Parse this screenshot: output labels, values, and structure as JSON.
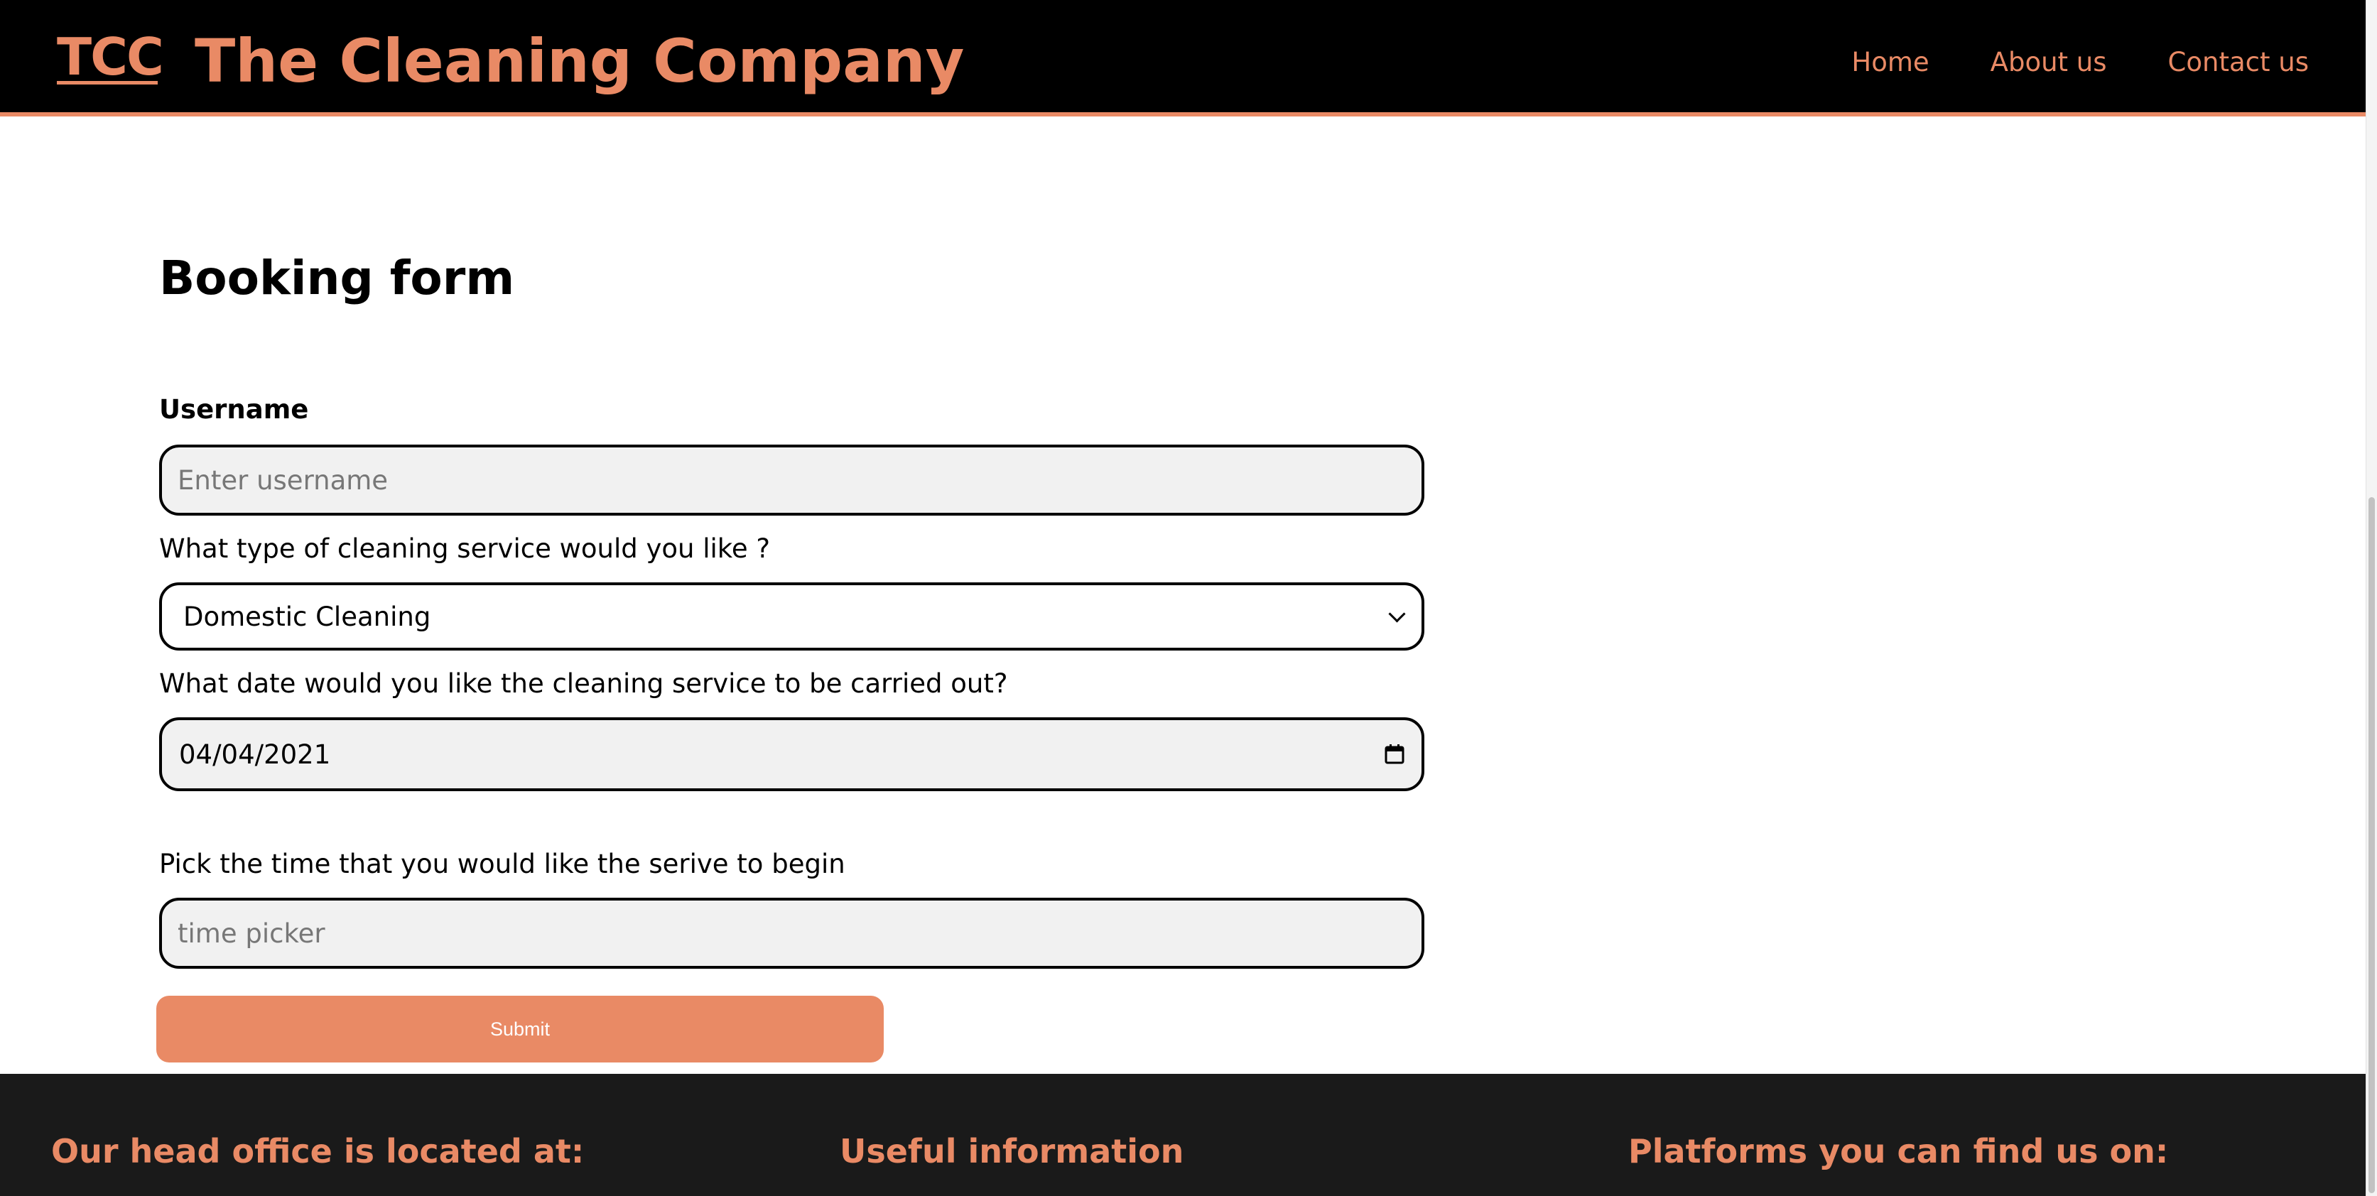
{
  "header": {
    "logo_text": "TCC",
    "site_title": "The Cleaning Company",
    "nav": [
      {
        "label": "Home"
      },
      {
        "label": "About us"
      },
      {
        "label": "Contact us"
      }
    ]
  },
  "form": {
    "title": "Booking form",
    "username_label": "Username",
    "username_placeholder": "Enter username",
    "username_value": "",
    "service_label": "What type of cleaning service would you like ?",
    "service_selected": "Domestic Cleaning",
    "date_label": "What date would you like the cleaning service to be carried out?",
    "date_value": "04/04/2021",
    "time_label": "Pick the time that you would like the serive to begin",
    "time_placeholder": "time picker",
    "time_value": "",
    "submit_label": "Submit"
  },
  "footer": {
    "headings": [
      "Our head office is located at:",
      "Useful information",
      "Platforms you can find us on:"
    ]
  },
  "colors": {
    "accent": "#e98a65",
    "header_bg": "#000000",
    "footer_bg": "#1a1a1a",
    "field_bg": "#f1f1f1"
  },
  "icons": {
    "date_field": "calendar-icon",
    "select": "chevron-down-icon"
  }
}
